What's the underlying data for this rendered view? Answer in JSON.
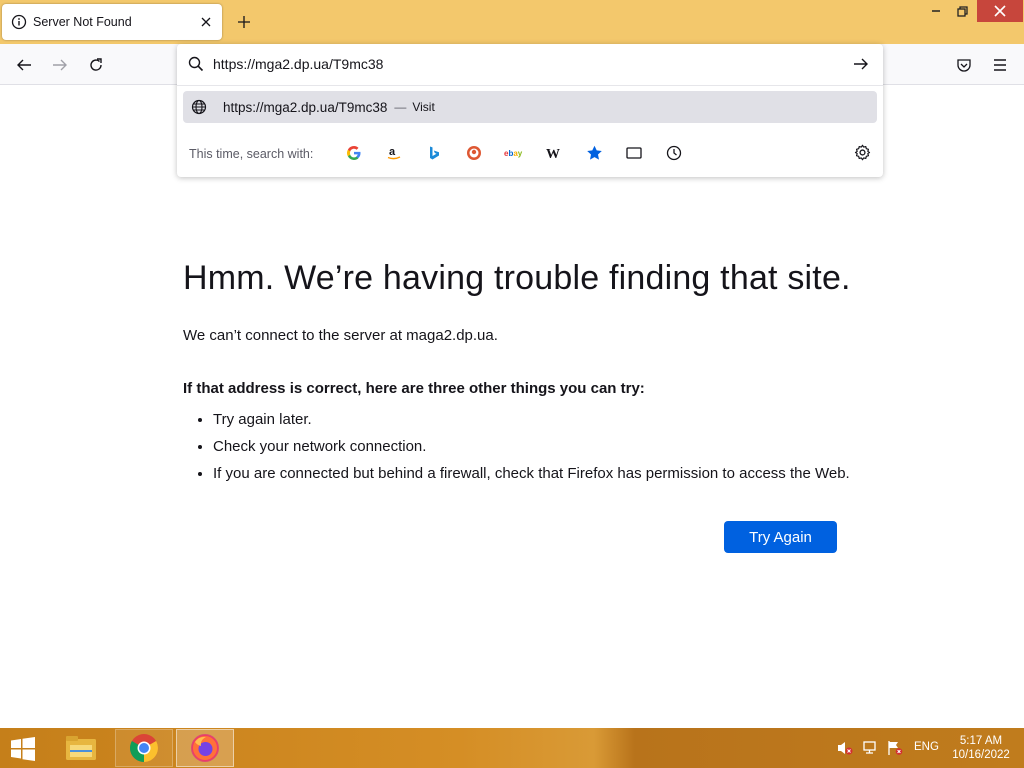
{
  "tab": {
    "title": "Server Not Found"
  },
  "urlbar": {
    "value": "https://mga2.dp.ua/T9mc38",
    "suggestion_url": "https://mga2.dp.ua/T9mc38",
    "suggestion_sep": "—",
    "suggestion_action": "Visit",
    "search_with_label": "This time, search with:",
    "engines": [
      "google-icon",
      "amazon-icon",
      "bing-icon",
      "duckduckgo-icon",
      "ebay-icon",
      "wikipedia-icon",
      "bookmarks-icon",
      "tabs-icon",
      "history-icon"
    ]
  },
  "page": {
    "headline": "Hmm. We’re having trouble finding that site.",
    "message": "We can’t connect to the server at maga2.dp.ua.",
    "tips_title": "If that address is correct, here are three other things you can try:",
    "tips": [
      "Try again later.",
      "Check your network connection.",
      "If you are connected but behind a firewall, check that Firefox has permission to access the Web."
    ],
    "try_again_label": "Try Again"
  },
  "taskbar": {
    "lang": "ENG",
    "time": "5:17 AM",
    "date": "10/16/2022"
  },
  "colors": {
    "titlebar": "#f3c86c",
    "primary_button": "#0061e0",
    "close_button": "#c7463c"
  }
}
